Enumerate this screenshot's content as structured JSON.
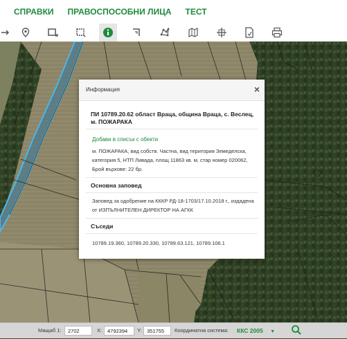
{
  "menu": {
    "items": [
      "СПРАВКИ",
      "ПРАВОСПОСОБНИ ЛИЦА",
      "ТЕСТ"
    ]
  },
  "colors": {
    "accent": "#1f8a3c",
    "parcel_highlight": "#49b8e8"
  },
  "toolbar": {
    "icons": [
      "move-icon",
      "location-pin-icon",
      "select-rectangle-icon",
      "zoom-rectangle-icon",
      "info-icon",
      "polyline-icon",
      "polygon-icon",
      "map-icon",
      "crosshair-icon",
      "document-icon",
      "print-icon"
    ],
    "active": "info-icon"
  },
  "popup": {
    "title": "Информация",
    "close": "×",
    "parcel_title": "ПИ 10789.20.62 област Враца, община Враца, с. Веслец, м. ПОЖАРАКА",
    "add_link": "Добави в списък с обекти",
    "description": "м. ПОЖАРАКА, вид собств. Частна, вид територия Земеделска, категория 5, НТП Ливада, площ 11863 кв. м, стар номер 020062, Брой върхове: 22 бр.",
    "order_heading": "Основна заповед",
    "order_text": "Заповед за одобрение на КККР РД-18-1703/17.10.2018 г., издадена от ИЗПЪЛНИТЕЛЕН ДИРЕКТОР НА АГКК",
    "neighbors_heading": "Съседи",
    "neighbors_text": "10789.19.360, 10789.20.330, 10789.63.121, 10789.106.1"
  },
  "statusbar": {
    "scale_label": "Мащаб 1:",
    "scale_value": "2702",
    "x_label": "X:",
    "x_value": "4792394",
    "y_label": "Y:",
    "y_value": "351755",
    "coord_label": "Координатна система:",
    "coord_value": "ККС 2005"
  }
}
